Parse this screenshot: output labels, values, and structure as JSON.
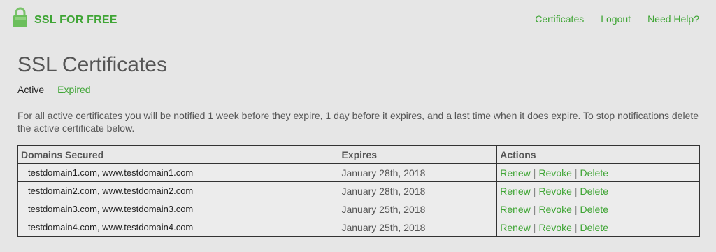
{
  "header": {
    "brand": "SSL FOR FREE",
    "nav": [
      {
        "label": "Certificates"
      },
      {
        "label": "Logout"
      },
      {
        "label": "Need Help?"
      }
    ]
  },
  "page": {
    "title": "SSL Certificates",
    "tabs": {
      "active": "Active",
      "expired": "Expired"
    },
    "notice": "For all active certificates you will be notified 1 week before they expire, 1 day before it expires, and a last time when it does expire. To stop notifications delete the active certificate below."
  },
  "table": {
    "headers": {
      "domains": "Domains Secured",
      "expires": "Expires",
      "actions": "Actions"
    },
    "actions": {
      "renew": "Renew",
      "revoke": "Revoke",
      "delete": "Delete",
      "separator": "|"
    },
    "rows": [
      {
        "domains": "testdomain1.com, www.testdomain1.com",
        "expires": "January 28th, 2018"
      },
      {
        "domains": "testdomain2.com, www.testdomain2.com",
        "expires": "January 28th, 2018"
      },
      {
        "domains": "testdomain3.com, www.testdomain3.com",
        "expires": "January 25th, 2018"
      },
      {
        "domains": "testdomain4.com, www.testdomain4.com",
        "expires": "January 25th, 2018"
      }
    ]
  },
  "colors": {
    "accent": "#3fa535",
    "background": "#e6e6e6",
    "text": "#555555"
  },
  "icons": {
    "brand_icon": "lock-icon"
  }
}
